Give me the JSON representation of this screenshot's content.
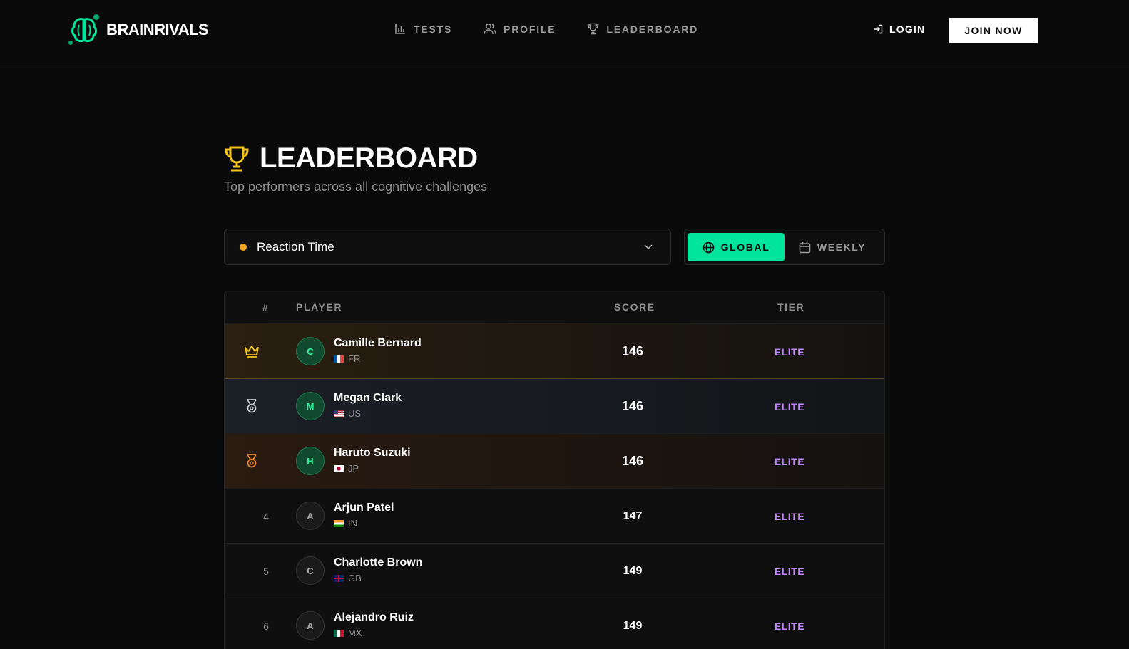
{
  "brand": {
    "name": "BRAINRIVALS",
    "accent": "#00e59b"
  },
  "nav": [
    {
      "label": "TESTS",
      "icon": "bar-chart-icon"
    },
    {
      "label": "PROFILE",
      "icon": "users-icon"
    },
    {
      "label": "LEADERBOARD",
      "icon": "trophy-icon"
    }
  ],
  "auth": {
    "login_label": "LOGIN",
    "join_label": "JOIN NOW"
  },
  "page": {
    "title": "LEADERBOARD",
    "subtitle": "Top performers across all cognitive challenges"
  },
  "filters": {
    "test_select": {
      "value": "Reaction Time",
      "dot_color": "#f5a623"
    },
    "scope": {
      "global_label": "GLOBAL",
      "weekly_label": "WEEKLY",
      "selected": "GLOBAL"
    }
  },
  "table": {
    "headers": {
      "rank": "#",
      "player": "PLAYER",
      "score": "SCORE",
      "tier": "TIER"
    },
    "rows": [
      {
        "rank": "1",
        "medal": "crown-icon",
        "initial": "C",
        "name": "Camille Bernard",
        "country": "FR",
        "score": "146",
        "tier": "ELITE"
      },
      {
        "rank": "2",
        "medal": "silver-medal-icon",
        "initial": "M",
        "name": "Megan Clark",
        "country": "US",
        "score": "146",
        "tier": "ELITE"
      },
      {
        "rank": "3",
        "medal": "bronze-medal-icon",
        "initial": "H",
        "name": "Haruto Suzuki",
        "country": "JP",
        "score": "146",
        "tier": "ELITE"
      },
      {
        "rank": "4",
        "initial": "A",
        "name": "Arjun Patel",
        "country": "IN",
        "score": "147",
        "tier": "ELITE"
      },
      {
        "rank": "5",
        "initial": "C",
        "name": "Charlotte Brown",
        "country": "GB",
        "score": "149",
        "tier": "ELITE"
      },
      {
        "rank": "6",
        "initial": "A",
        "name": "Alejandro Ruiz",
        "country": "MX",
        "score": "149",
        "tier": "ELITE"
      }
    ]
  },
  "colors": {
    "gold": "#f5c518",
    "silver": "#c9ced6",
    "bronze": "#f08a24",
    "tier_elite": "#c084fc"
  }
}
